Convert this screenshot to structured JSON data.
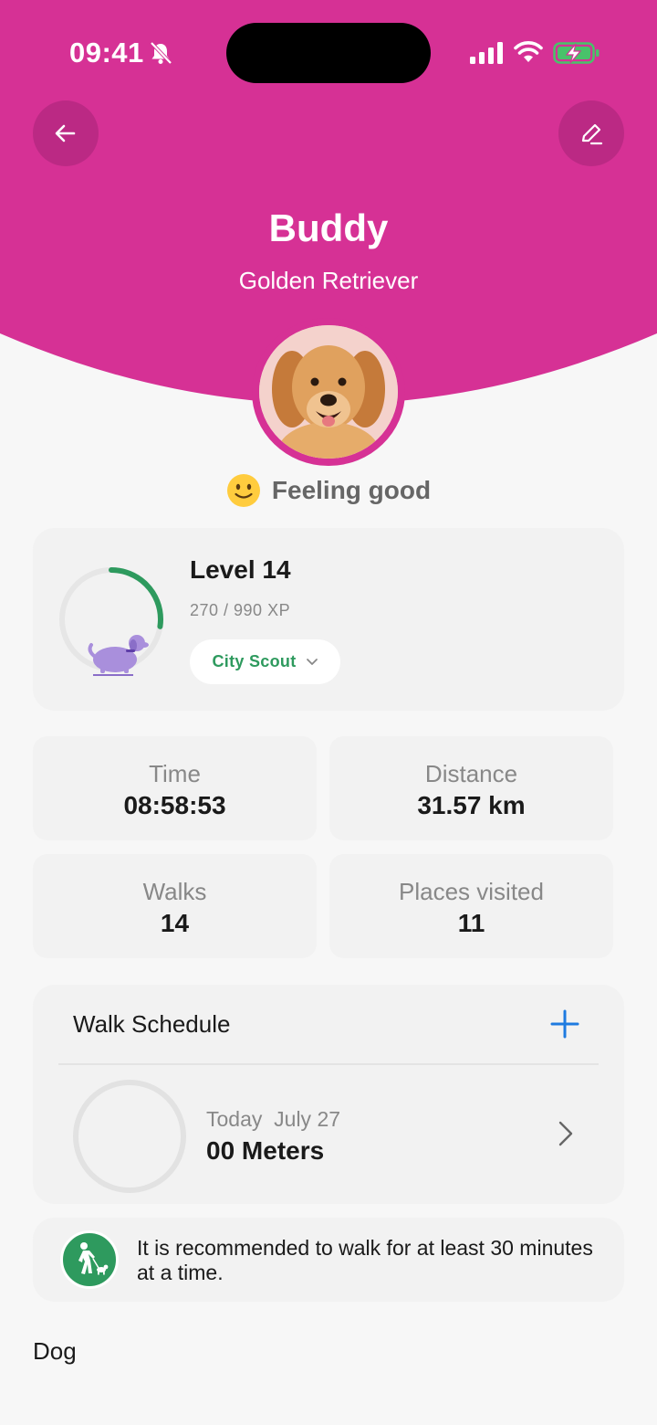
{
  "status_bar": {
    "time": "09:41",
    "icons": [
      "bell-slash-icon",
      "signal-icon",
      "wifi-icon",
      "battery-charging-icon"
    ]
  },
  "header": {
    "back_icon": "arrow-left-icon",
    "edit_icon": "pencil-icon",
    "pet_name": "Buddy",
    "pet_breed": "Golden Retriever",
    "avatar": "golden-retriever-photo"
  },
  "mood": {
    "emoji": "slightly-smiling-face",
    "label": "Feeling good"
  },
  "level": {
    "title": "Level 14",
    "xp": "270 / 990 XP",
    "progress": 0.273,
    "badge_icon": "dog-icon",
    "title_label": "City Scout",
    "title_icon": "chevron-down-icon"
  },
  "stats": [
    {
      "label": "Time",
      "value": "08:58:53"
    },
    {
      "label": "Distance",
      "value": "31.57 km"
    },
    {
      "label": "Walks",
      "value": "14"
    },
    {
      "label": "Places visited",
      "value": "11"
    }
  ],
  "schedule": {
    "title": "Walk Schedule",
    "add_icon": "plus-icon",
    "date": "Today  July 27",
    "distance": "00 Meters",
    "progress": 0,
    "nav_icon": "chevron-right-icon"
  },
  "tip": {
    "icon": "person-walking-dog-icon",
    "text": "It is recommended to walk for at least 30 minutes at a time."
  },
  "section_label": "Dog",
  "colors": {
    "header": "#d63195",
    "accent_green": "#2e9a5e",
    "accent_blue": "#1e7be0",
    "card": "#f2f2f2",
    "background": "#f7f7f7"
  }
}
